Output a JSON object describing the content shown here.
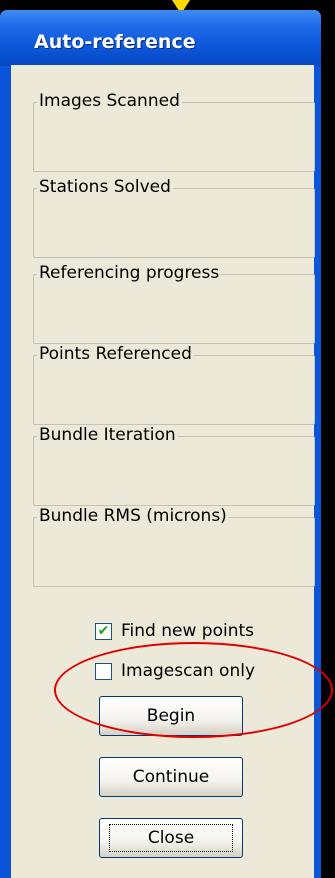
{
  "window": {
    "title": "Auto-reference"
  },
  "groups": [
    {
      "label": "Images Scanned",
      "value": ""
    },
    {
      "label": "Stations Solved",
      "value": ""
    },
    {
      "label": "Referencing progress",
      "value": ""
    },
    {
      "label": "Points Referenced",
      "value": ""
    },
    {
      "label": "Bundle Iteration",
      "value": ""
    },
    {
      "label": "Bundle RMS (microns)",
      "value": ""
    }
  ],
  "options": {
    "find_new_points": {
      "label": "Find new points",
      "checked": true,
      "mark": "✔"
    },
    "imagescan_only": {
      "label": "Imagescan only",
      "checked": false
    }
  },
  "buttons": {
    "begin": "Begin",
    "continue": "Continue",
    "close": "Close"
  },
  "annotation": {
    "color": "#e00000",
    "arrow_color": "#ffd800"
  }
}
